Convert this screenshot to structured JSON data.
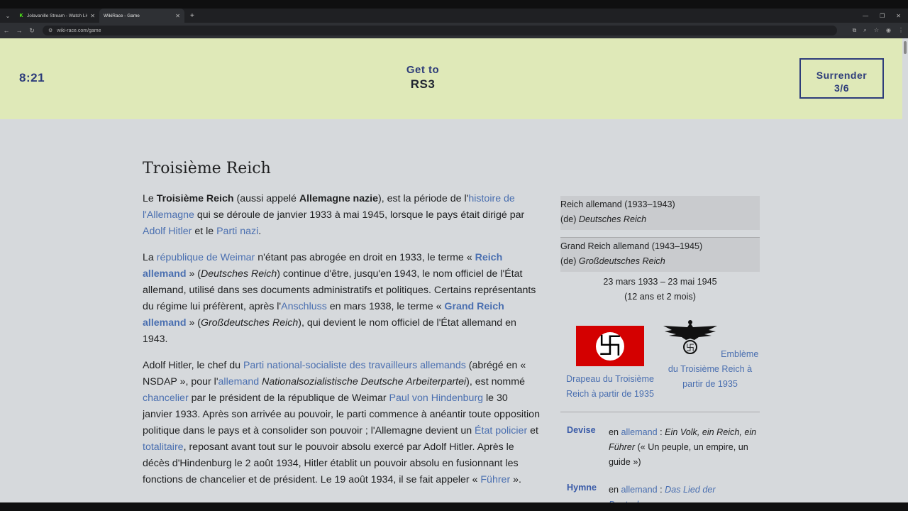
{
  "browser": {
    "tabs": [
      {
        "title": "Jolavanille Stream - Watch Live"
      },
      {
        "title": "WikiRace - Game"
      }
    ],
    "url": "wiki-race.com/game"
  },
  "game": {
    "timer": "8:21",
    "target_label": "Get to",
    "target": "RS3",
    "surrender_label": "Surrender",
    "surrender_count": "3/6"
  },
  "article": {
    "title": "Troisième Reich",
    "p1": {
      "t1": "Le ",
      "b1": "Troisième Reich",
      "t2": " (aussi appelé ",
      "b2": "Allemagne nazie",
      "t3": "), est la période de l'",
      "l1": "histoire de l'Allemagne",
      "t4": " qui se déroule de janvier 1933 à mai 1945, lorsque le pays était dirigé par ",
      "l2": "Adolf Hitler",
      "t5": " et le ",
      "l3": "Parti nazi",
      "t6": "."
    },
    "p2": {
      "t1": "La ",
      "l1": "république de Weimar",
      "t2": " n'étant pas abrogée en droit en 1933, le terme « ",
      "l2": "Reich allemand",
      "t3": " » (",
      "i1": "Deutsches Reich",
      "t4": ") continue d'être, jusqu'en 1943, le nom officiel de l'État allemand, utilisé dans ses documents administratifs et politiques. Certains représentants du régime lui préfèrent, après l'",
      "l3": "Anschluss",
      "t5": " en mars 1938, le terme « ",
      "l4": "Grand Reich allemand",
      "t6": " » (",
      "i2": "Großdeutsches Reich",
      "t7": "), qui devient le nom officiel de l'État allemand en 1943."
    },
    "p3": {
      "t1": "Adolf Hitler, le chef du ",
      "l1": "Parti national-socialiste des travailleurs allemands",
      "t2": " (abrégé en « NSDAP », pour l'",
      "l2": "allemand",
      "t3": " ",
      "i1": "Nationalsozialistische Deutsche Arbeiterpartei",
      "t4": "), est nommé ",
      "l3": "chancelier",
      "t5": " par le président de la république de Weimar ",
      "l4": "Paul von Hindenburg",
      "t6": " le 30 janvier 1933. Après son arrivée au pouvoir, le parti commence à anéantir toute opposition politique dans le pays et à consolider son pouvoir ; l'Allemagne devient un ",
      "l5": "État policier",
      "t7": " et ",
      "l6": "totalitaire",
      "t8": ", reposant avant tout sur le pouvoir absolu exercé par Adolf Hitler. Après le décès d'Hindenburg le 2 août 1934, Hitler établit un pouvoir absolu en fusionnant les fonctions de chancelier et de président. Le 19 août 1934, il se fait appeler « ",
      "l7": "Führer",
      "t9": " »."
    }
  },
  "infobox": {
    "name1": "Reich allemand (1933–1943)",
    "name1_de_prefix": "(de) ",
    "name1_de": "Deutsches Reich",
    "name2": "Grand Reich allemand (1943–1945)",
    "name2_de_prefix": "(de) ",
    "name2_de": "Großdeutsches Reich",
    "dates": "23 mars 1933 – 23 mai 1945",
    "duration": "(12 ans et 2 mois)",
    "flag_caption": "Drapeau du Troisième Reich à partir de 1935",
    "emblem_caption": "Emblème du Troisième Reich à partir de 1935",
    "devise_label": "Devise",
    "devise_prefix": "en ",
    "devise_lang": "allemand",
    "devise_sep": " : ",
    "devise_text": "Ein Volk, ein Reich, ein Führer",
    "devise_trans": " (« Un peuple, un empire, un guide »)",
    "hymne_label": "Hymne",
    "hymne_prefix": "en ",
    "hymne_lang": "allemand",
    "hymne_sep": " : ",
    "hymne_text": "Das Lied der Deutschen"
  },
  "colors": {
    "header_bg": "#dfe9b8",
    "accent": "#2d3c7a",
    "link": "#4a6fb0",
    "page_bg": "#d6d9dc"
  }
}
